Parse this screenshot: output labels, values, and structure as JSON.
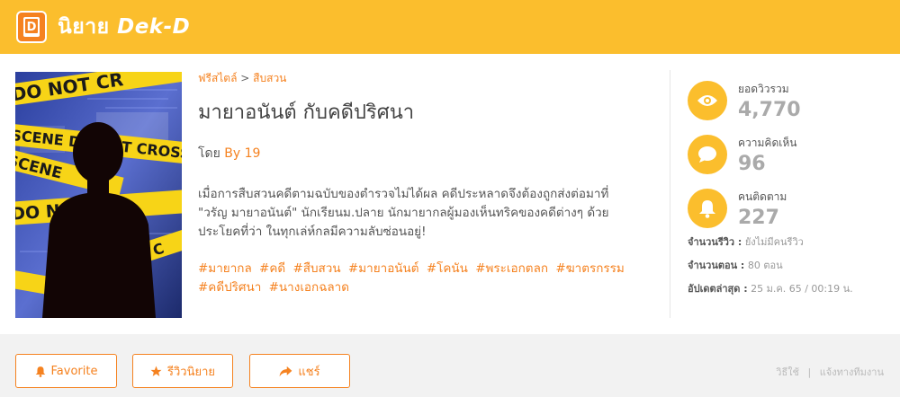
{
  "header": {
    "brand_th": "นิยาย",
    "brand_en": "Dek-D",
    "logo_letter": "D"
  },
  "cover": {
    "tape_text_1": "DO NOT CR",
    "tape_text_2": "SCENE DO NOT CROSS",
    "tape_text_3": "SCENE",
    "tape_text_4": "DO NOT",
    "tape_text_5": "NOT C"
  },
  "breadcrumb": {
    "category": "ฟรีสไตล์",
    "separator": ">",
    "subcategory": "สืบสวน"
  },
  "novel": {
    "title": "มายาอนันต์ กับคดีปริศนา",
    "author_prefix": "โดย",
    "author": "By 19",
    "description": "เมื่อการสืบสวนคดีตามฉบับของตำรวจไม่ได้ผล คดีประหลาดจึงต้องถูกส่งต่อมาที่ \"วรัญ มายาอนันต์\" นักเรียนม.ปลาย นักมายากลผู้มองเห็นทริคของคดีต่างๆ ด้วยประโยคที่ว่า ในทุกเล่ห์กลมีความลับซ่อนอยู่!",
    "tags": [
      "#มายากล",
      "#คดี",
      "#สืบสวน",
      "#มายาอนันต์",
      "#โคนัน",
      "#พระเอกตลก",
      "#ฆาตรกรรม",
      "#คดีปริศนา",
      "#นางเอกฉลาด"
    ]
  },
  "stats": [
    {
      "label": "ยอดวิวรวม",
      "value": "4,770",
      "icon": "eye-icon"
    },
    {
      "label": "ความคิดเห็น",
      "value": "96",
      "icon": "comment-icon"
    },
    {
      "label": "คนติดตาม",
      "value": "227",
      "icon": "bell-icon"
    }
  ],
  "meta": {
    "reviews_label": "จำนวนรีวิว :",
    "reviews_value": "ยังไม่มีคนรีวิว",
    "episodes_label": "จำนวนตอน :",
    "episodes_value": "80 ตอน",
    "updated_label": "อัปเดตล่าสุด :",
    "updated_value": "25 ม.ค. 65 / 00:19 น."
  },
  "actions": {
    "favorite": "Favorite",
    "review": "รีวิวนิยาย",
    "share": "แชร์"
  },
  "footer_links": {
    "howto": "วิธีใช้",
    "separator": "|",
    "report": "แจ้งทางทีมงาน"
  },
  "colors": {
    "header_bg": "#fbbe2d",
    "accent": "#f58220",
    "stat_circle": "#fbbe2d"
  }
}
